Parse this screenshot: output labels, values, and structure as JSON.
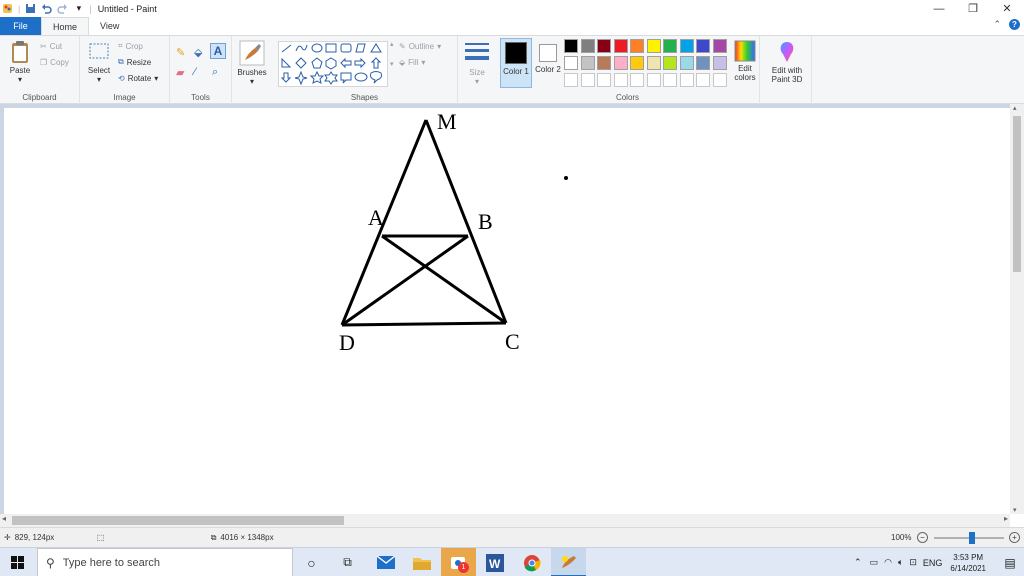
{
  "window": {
    "title": "Untitled - Paint"
  },
  "tabs": [
    "File",
    "Home",
    "View"
  ],
  "clipboard": {
    "paste": "Paste",
    "cut": "Cut",
    "copy": "Copy",
    "group": "Clipboard"
  },
  "image": {
    "select": "Select",
    "crop": "Crop",
    "resize": "Resize",
    "rotate": "Rotate",
    "group": "Image"
  },
  "tools": {
    "group": "Tools"
  },
  "brushes": {
    "label": "Brushes"
  },
  "shapes": {
    "outline": "Outline",
    "fill": "Fill",
    "group": "Shapes"
  },
  "size": {
    "label": "Size"
  },
  "colors": {
    "color1": "Color 1",
    "color2": "Color 2",
    "edit": "Edit colors",
    "group": "Colors",
    "paint3d": "Edit with Paint 3D",
    "palette_row1": [
      "#000000",
      "#7f7f7f",
      "#880015",
      "#ed1c24",
      "#ff7f27",
      "#fff200",
      "#22b14c",
      "#00a2e8",
      "#3f48cc",
      "#a349a4"
    ],
    "palette_row2": [
      "#ffffff",
      "#c3c3c3",
      "#b97a57",
      "#ffaec9",
      "#ffc90e",
      "#efe4b0",
      "#b5e61d",
      "#99d9ea",
      "#7092be",
      "#c8bfe7"
    ],
    "primary": "#000000",
    "secondary": "#ffffff"
  },
  "drawing": {
    "labels": [
      "M",
      "A",
      "B",
      "D",
      "C"
    ]
  },
  "status": {
    "cursor": "829, 124px",
    "image_size": "4016 × 1348px",
    "zoom": "100%",
    "zoom_fraction": 0.55
  },
  "taskbar": {
    "search_placeholder": "Type here to search",
    "lang": "ENG",
    "time": "3:53 PM",
    "date": "6/14/2021",
    "badge": "1"
  }
}
